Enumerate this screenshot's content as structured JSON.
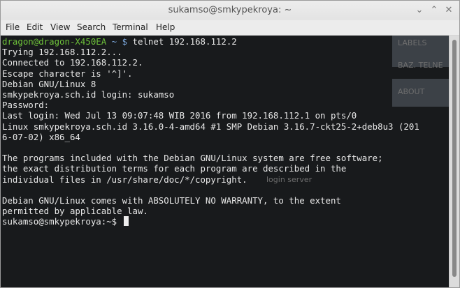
{
  "window": {
    "title": "sukamso@smkypekroya: ~",
    "minimize_glyph": "⌄",
    "maximize_glyph": "⌃",
    "close_glyph": "✕"
  },
  "menu": {
    "items": [
      "File",
      "Edit",
      "View",
      "Search",
      "Terminal",
      "Help"
    ]
  },
  "terminal": {
    "prompt1_user": "dragon@dragon-X450EA",
    "prompt1_path": "~",
    "prompt1_symbol": "$",
    "command": "telnet 192.168.112.2",
    "output_lines": [
      "Trying 192.168.112.2...",
      "Connected to 192.168.112.2.",
      "Escape character is '^]'.",
      "Debian GNU/Linux 8",
      "smkypekroya.sch.id login: sukamso",
      "Password:",
      "Last login: Wed Jul 13 09:07:48 WIB 2016 from 192.168.112.1 on pts/0",
      "Linux smkypekroya.sch.id 3.16.0-4-amd64 #1 SMP Debian 3.16.7-ckt25-2+deb8u3 (201",
      "6-07-02) x86_64",
      "",
      "The programs included with the Debian GNU/Linux system are free software;",
      "the exact distribution terms for each program are described in the",
      "individual files in /usr/share/doc/*/copyright.",
      "",
      "Debian GNU/Linux comes with ABSOLUTELY NO WARRANTY, to the extent",
      "permitted by applicable law."
    ],
    "prompt2": "sukamso@smkypekroya:~$ "
  },
  "background": {
    "labels": [
      "LABELS",
      "BAZ. TELNE",
      "ABOUT",
      "login server"
    ]
  }
}
